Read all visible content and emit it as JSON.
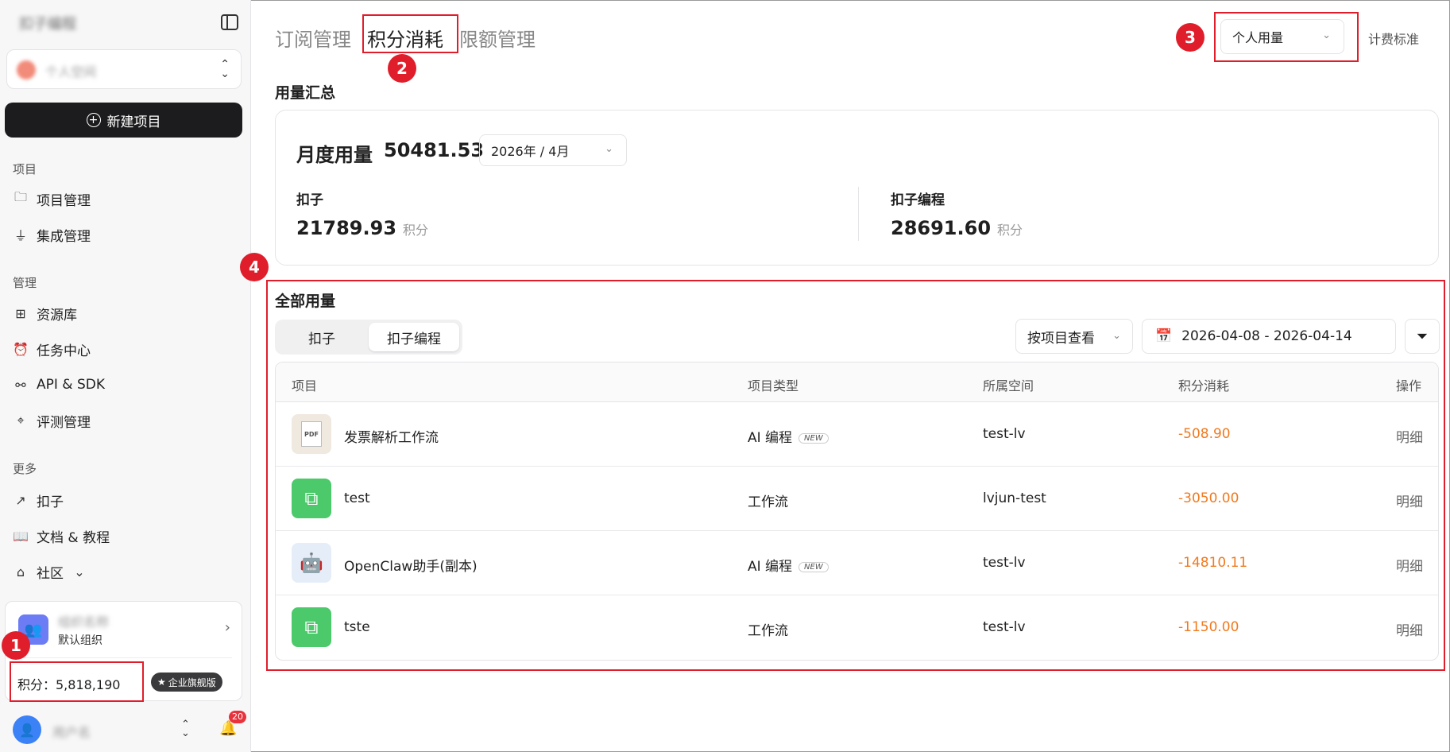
{
  "sidebar": {
    "logo_text": "扣子编程",
    "workspace_name": "个人空间",
    "new_project": "新建项目",
    "sections": {
      "project": "项目",
      "manage": "管理",
      "more": "更多"
    },
    "items": {
      "project_mgmt": "项目管理",
      "integration": "集成管理",
      "library": "资源库",
      "tasks": "任务中心",
      "api": "API & SDK",
      "eval": "评测管理",
      "coze": "扣子",
      "docs": "文档 & 教程",
      "community": "社区"
    },
    "org_name": "组织名称",
    "org_sub": "默认组织",
    "points_label": "积分：5,818,190",
    "edition_badge": "企业旗舰版",
    "user_name": "用户名",
    "notif_count": "20"
  },
  "header": {
    "tabs": [
      "订阅管理",
      "积分消耗",
      "限额管理"
    ],
    "usage_select": "个人用量",
    "billing_link": "计费标准"
  },
  "summary": {
    "title": "用量汇总",
    "monthly_label": "月度用量",
    "monthly_value": "50481.53",
    "month": "2026年 / 4月",
    "metrics": [
      {
        "name": "扣子",
        "value": "21789.93",
        "unit": "积分"
      },
      {
        "name": "扣子编程",
        "value": "28691.60",
        "unit": "积分"
      }
    ]
  },
  "all_usage": {
    "title": "全部用量",
    "segments": [
      "扣子",
      "扣子编程"
    ],
    "view_select": "按项目查看",
    "date_range": "2026-04-08 - 2026-04-14",
    "columns": [
      "项目",
      "项目类型",
      "所属空间",
      "积分消耗",
      "操作"
    ],
    "new_tag": "NEW",
    "pdf_label": "PDF",
    "rows": [
      {
        "name": "发票解析工作流",
        "type": "AI 编程",
        "is_new": true,
        "space": "test-lv",
        "cost": "-508.90",
        "op": "明细",
        "icon": "pdf-icon"
      },
      {
        "name": "test",
        "type": "工作流",
        "is_new": false,
        "space": "lvjun-test",
        "cost": "-3050.00",
        "op": "明细",
        "icon": "workflow-icon"
      },
      {
        "name": "OpenClaw助手(副本)",
        "type": "AI 编程",
        "is_new": true,
        "space": "test-lv",
        "cost": "-14810.11",
        "op": "明细",
        "icon": "robot-icon"
      },
      {
        "name": "tste",
        "type": "工作流",
        "is_new": false,
        "space": "test-lv",
        "cost": "-1150.00",
        "op": "明细",
        "icon": "workflow-icon"
      }
    ]
  },
  "markers": [
    "1",
    "2",
    "3",
    "4"
  ],
  "colors": {
    "highlight": "#e01e2b",
    "cost": "#f07a1f",
    "primary_button": "#1c1c1e"
  }
}
